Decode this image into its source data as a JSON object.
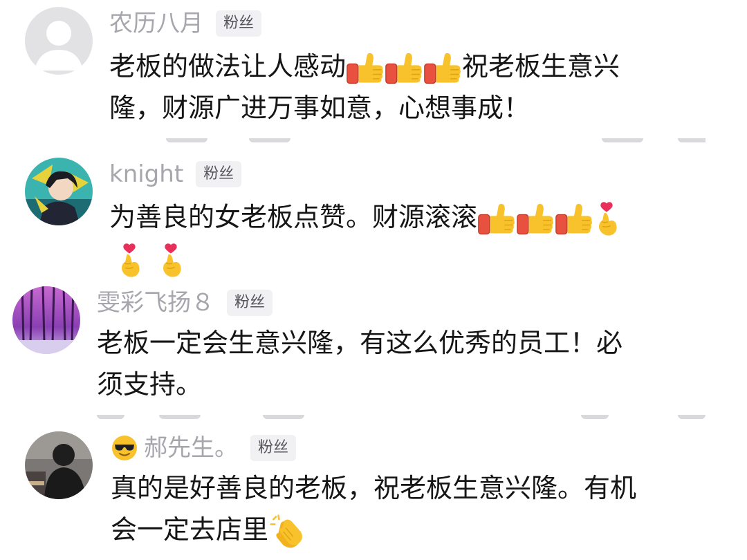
{
  "comments": [
    {
      "username": "农历八月",
      "badge": "粉丝",
      "avatar": "default-avatar-icon",
      "lines": [
        "老板的做法让人感动",
        "祝老板生意兴",
        "隆，财源广进万事如意，心想事成！"
      ],
      "emojis": [
        "thumbs-up-icon",
        "thumbs-up-icon",
        "thumbs-up-icon"
      ]
    },
    {
      "username": "knight",
      "badge": "粉丝",
      "avatar": "anime-avatar",
      "lines": [
        "为善良的女老板点赞。财源滚滚"
      ],
      "emojis": [
        "thumbs-up-icon",
        "thumbs-up-icon",
        "thumbs-up-icon",
        "finger-heart-icon",
        "finger-heart-icon",
        "finger-heart-icon"
      ]
    },
    {
      "username": "雯彩飞扬８",
      "badge": "粉丝",
      "avatar": "purple-forest-avatar",
      "lines": [
        "老板一定会生意兴隆，有这么优秀的员工！必",
        "须支持。"
      ]
    },
    {
      "username": "郝先生。",
      "badge": "粉丝",
      "avatar": "person-photo-avatar",
      "name_emoji": "sunglasses-icon",
      "lines": [
        "真的是好善良的老板，祝老板生意兴隆。有机",
        "会一定去店里"
      ],
      "emojis": [
        "clapping-hands-icon"
      ]
    }
  ],
  "colors": {
    "username": "#a6a6ad",
    "text": "#161616",
    "badge_bg": "#f1f1f4",
    "thumb": "#f7c22b",
    "sleeve": "#e8503f",
    "heart": "#e8305a"
  }
}
